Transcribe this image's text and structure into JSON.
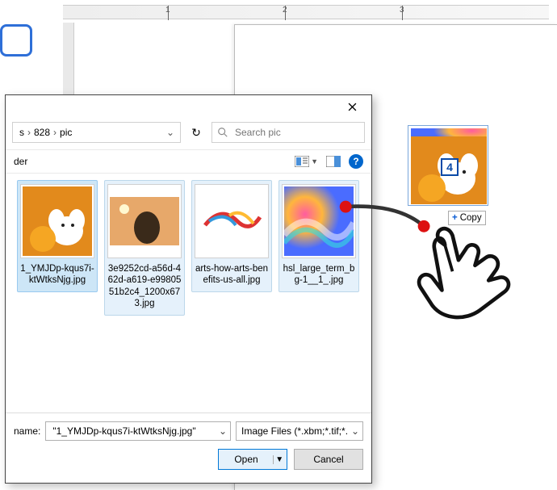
{
  "ruler": {
    "num1": "1",
    "num2": "2",
    "num3": "3"
  },
  "dialog": {
    "breadcrumb": {
      "parent": "s",
      "mid": "828",
      "current": "pic"
    },
    "search": {
      "placeholder": "Search pic"
    },
    "toolbar": {
      "left_label": "der"
    },
    "files": [
      {
        "name": "1_YMJDp-kqus7i-ktWtksNjg.jpg"
      },
      {
        "name": "3e9252cd-a56d-462d-a619-e9980551b2c4_1200x673.jpg"
      },
      {
        "name": "arts-how-arts-benefits-us-all.jpg"
      },
      {
        "name": "hsl_large_term_bg-1__1_.jpg"
      }
    ],
    "filename_label": "name:",
    "filename_value": "\"1_YMJDp-kqus7i-ktWtksNjg.jpg\"",
    "filetype_value": "Image Files (*.xbm;*.tif;*.pjp;*.a",
    "open_label": "Open",
    "cancel_label": "Cancel"
  },
  "drag": {
    "badge_count": "4",
    "copy_label": "Copy"
  }
}
